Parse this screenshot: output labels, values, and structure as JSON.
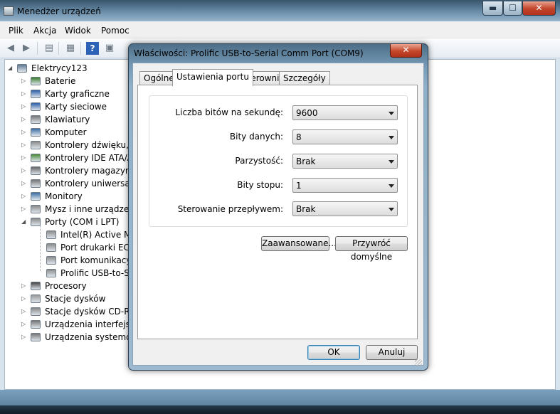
{
  "main_window": {
    "title": "Menedżer urządzeń",
    "controls": {
      "minimize": "▬",
      "maximize": "☐",
      "close": "✕"
    },
    "menu": [
      "Plik",
      "Akcja",
      "Widok",
      "Pomoc"
    ],
    "toolbar_icons": [
      "back-arrow-icon",
      "forward-arrow-icon",
      "tree-view-icon",
      "properties-icon",
      "help-icon",
      "update-driver-icon"
    ],
    "tree": {
      "root": "Elektrycy123",
      "categories": [
        "Baterie",
        "Karty graficzne",
        "Karty sieciowe",
        "Klawiatury",
        "Komputer",
        "Kontrolery dźwięku, w",
        "Kontrolery IDE ATA/A",
        "Kontrolery magazynu",
        "Kontrolery uniwersaln",
        "Monitory",
        "Mysz i inne urządzeni",
        "Porty (COM i LPT)",
        "Procesory",
        "Stacje dysków",
        "Stacje dysków CD-RO",
        "Urządzenia interfejsu",
        "Urządzenia systemow"
      ],
      "ports_children": [
        "Intel(R) Active Ma",
        "Port drukarki ECP",
        "Port komunikacyj",
        "Prolific USB-to-Se"
      ]
    }
  },
  "dialog": {
    "title": "Właściwości: Prolific USB-to-Serial Comm Port (COM9)",
    "close": "✕",
    "tabs": [
      "Ogólne",
      "Ustawienia portu",
      "Sterownik",
      "Szczegóły"
    ],
    "active_tab": "Ustawienia portu",
    "fields": [
      {
        "label": "Liczba bitów na sekundę:",
        "value": "9600"
      },
      {
        "label": "Bity danych:",
        "value": "8"
      },
      {
        "label": "Parzystość:",
        "value": "Brak"
      },
      {
        "label": "Bity stopu:",
        "value": "1"
      },
      {
        "label": "Sterowanie przepływem:",
        "value": "Brak"
      }
    ],
    "buttons": {
      "advanced": "Zaawansowane...",
      "restore_defaults": "Przywróć domyślne",
      "ok": "OK",
      "cancel": "Anuluj"
    }
  },
  "colors": {
    "titlebar_glass": "#7599b5",
    "close_red": "#c4472b",
    "default_button_border": "#3c7fb1"
  }
}
